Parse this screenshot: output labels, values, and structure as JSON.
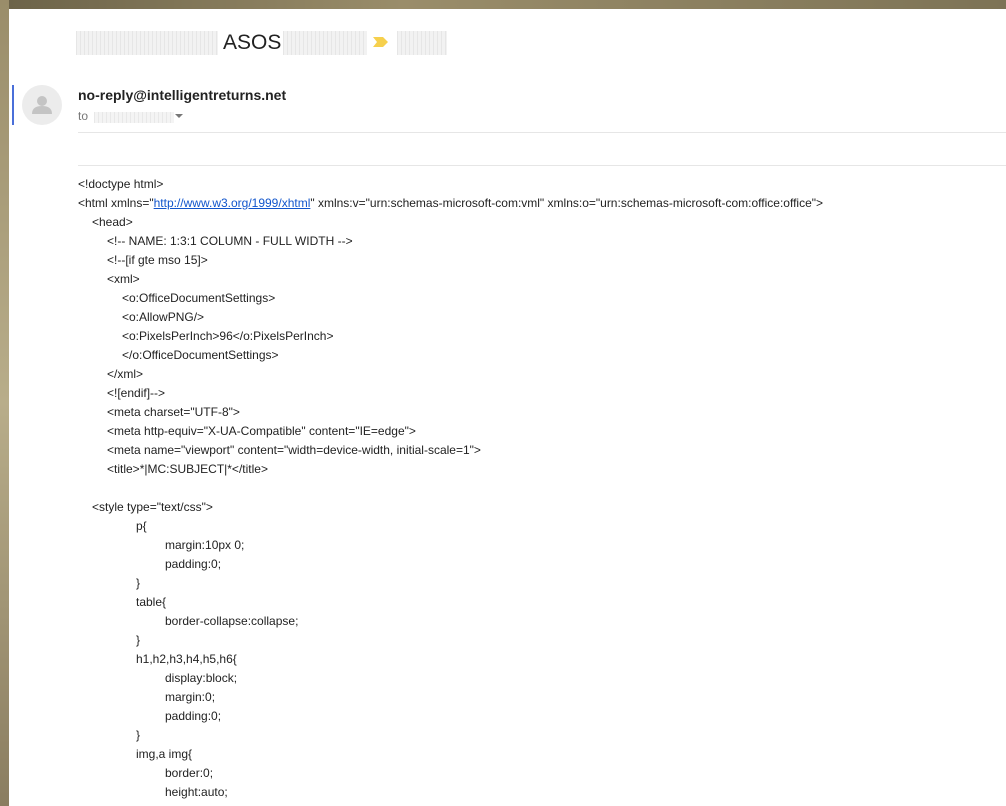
{
  "email": {
    "subject": "ASOS",
    "sender": "no-reply@intelligentreturns.net",
    "to_label": "to"
  },
  "colors": {
    "accent": "#4a6fd9",
    "link": "#1155cc",
    "label_tag": "#f6d04d"
  },
  "body_lines": [
    {
      "indent": 0,
      "text": "<!doctype html>"
    },
    {
      "indent": 0,
      "pre": "<html xmlns=\"",
      "link": "http://www.w3.org/1999/xhtml",
      "post": "\" xmlns:v=\"urn:schemas-microsoft-com:vml\" xmlns:o=\"urn:schemas-microsoft-com:office:office\">"
    },
    {
      "indent": 1,
      "text": "<head>"
    },
    {
      "indent": 2,
      "text": "<!-- NAME: 1:3:1 COLUMN - FULL WIDTH -->"
    },
    {
      "indent": 2,
      "text": "<!--[if gte mso 15]>"
    },
    {
      "indent": 2,
      "text": "<xml>"
    },
    {
      "indent": 3,
      "text": "<o:OfficeDocumentSettings>"
    },
    {
      "indent": 3,
      "text": "<o:AllowPNG/>"
    },
    {
      "indent": 3,
      "text": "<o:PixelsPerInch>96</o:PixelsPerInch>"
    },
    {
      "indent": 3,
      "text": "</o:OfficeDocumentSettings>"
    },
    {
      "indent": 2,
      "text": "</xml>"
    },
    {
      "indent": 2,
      "text": "<![endif]-->"
    },
    {
      "indent": 2,
      "text": "<meta charset=\"UTF-8\">"
    },
    {
      "indent": 2,
      "text": "<meta http-equiv=\"X-UA-Compatible\" content=\"IE=edge\">"
    },
    {
      "indent": 2,
      "text": "<meta name=\"viewport\" content=\"width=device-width, initial-scale=1\">"
    },
    {
      "indent": 2,
      "text": "<title>*|MC:SUBJECT|*</title>"
    },
    {
      "indent": 0,
      "text": ""
    },
    {
      "indent": 1,
      "text": "<style type=\"text/css\">"
    },
    {
      "indent": 4,
      "text": "p{"
    },
    {
      "indent": 6,
      "text": "margin:10px 0;"
    },
    {
      "indent": 6,
      "text": "padding:0;"
    },
    {
      "indent": 4,
      "text": "}"
    },
    {
      "indent": 4,
      "text": "table{"
    },
    {
      "indent": 6,
      "text": "border-collapse:collapse;"
    },
    {
      "indent": 4,
      "text": "}"
    },
    {
      "indent": 4,
      "text": "h1,h2,h3,h4,h5,h6{"
    },
    {
      "indent": 6,
      "text": "display:block;"
    },
    {
      "indent": 6,
      "text": "margin:0;"
    },
    {
      "indent": 6,
      "text": "padding:0;"
    },
    {
      "indent": 4,
      "text": "}"
    },
    {
      "indent": 4,
      "text": "img,a img{"
    },
    {
      "indent": 6,
      "text": "border:0;"
    },
    {
      "indent": 6,
      "text": "height:auto;"
    }
  ]
}
